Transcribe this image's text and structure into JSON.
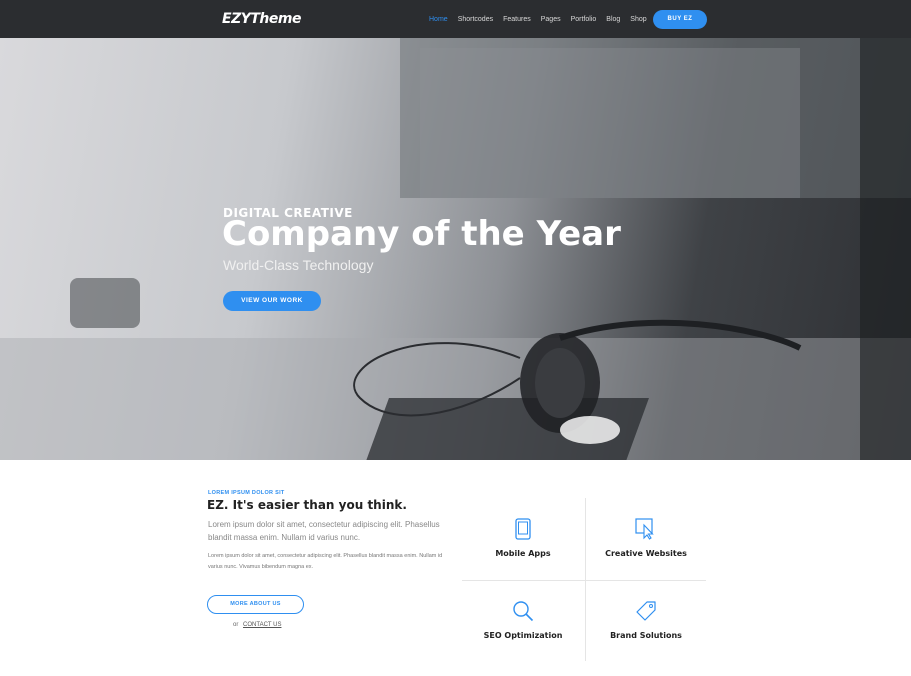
{
  "nav": {
    "logo": "EZYTheme",
    "links": [
      "Home",
      "Shortcodes",
      "Features",
      "Pages",
      "Portfolio",
      "Blog",
      "Shop"
    ],
    "active_link": "Home",
    "buy_label": "BUY EZ"
  },
  "hero": {
    "kicker": "DIGITAL CREATIVE",
    "title": "Company of the Year",
    "subtitle": "World-Class Technology",
    "cta": "VIEW OUR WORK"
  },
  "about": {
    "kicker": "LOREM IPSUM DOLOR SIT",
    "title": "EZ. It's easier than you think.",
    "lead": "Lorem ipsum dolor sit amet, consectetur adipiscing elit. Phasellus blandit massa enim. Nullam id varius nunc.",
    "body": "Lorem ipsum dolor sit amet, consectetur adipiscing elit. Phasellus blandit massa enim. Nullam id varius nunc. Vivamus bibendum magna ex.",
    "more_button": "MORE ABOUT US",
    "or_text": "or",
    "contact_link": "CONTACT US"
  },
  "services": [
    {
      "label": "Mobile Apps",
      "icon": "tablet-icon"
    },
    {
      "label": "Creative Websites",
      "icon": "cursor-icon"
    },
    {
      "label": "SEO Optimization",
      "icon": "search-icon"
    },
    {
      "label": "Brand Solutions",
      "icon": "tag-icon"
    }
  ],
  "colors": {
    "accent": "#2f8ff0",
    "navbar": "#2b2d30"
  }
}
